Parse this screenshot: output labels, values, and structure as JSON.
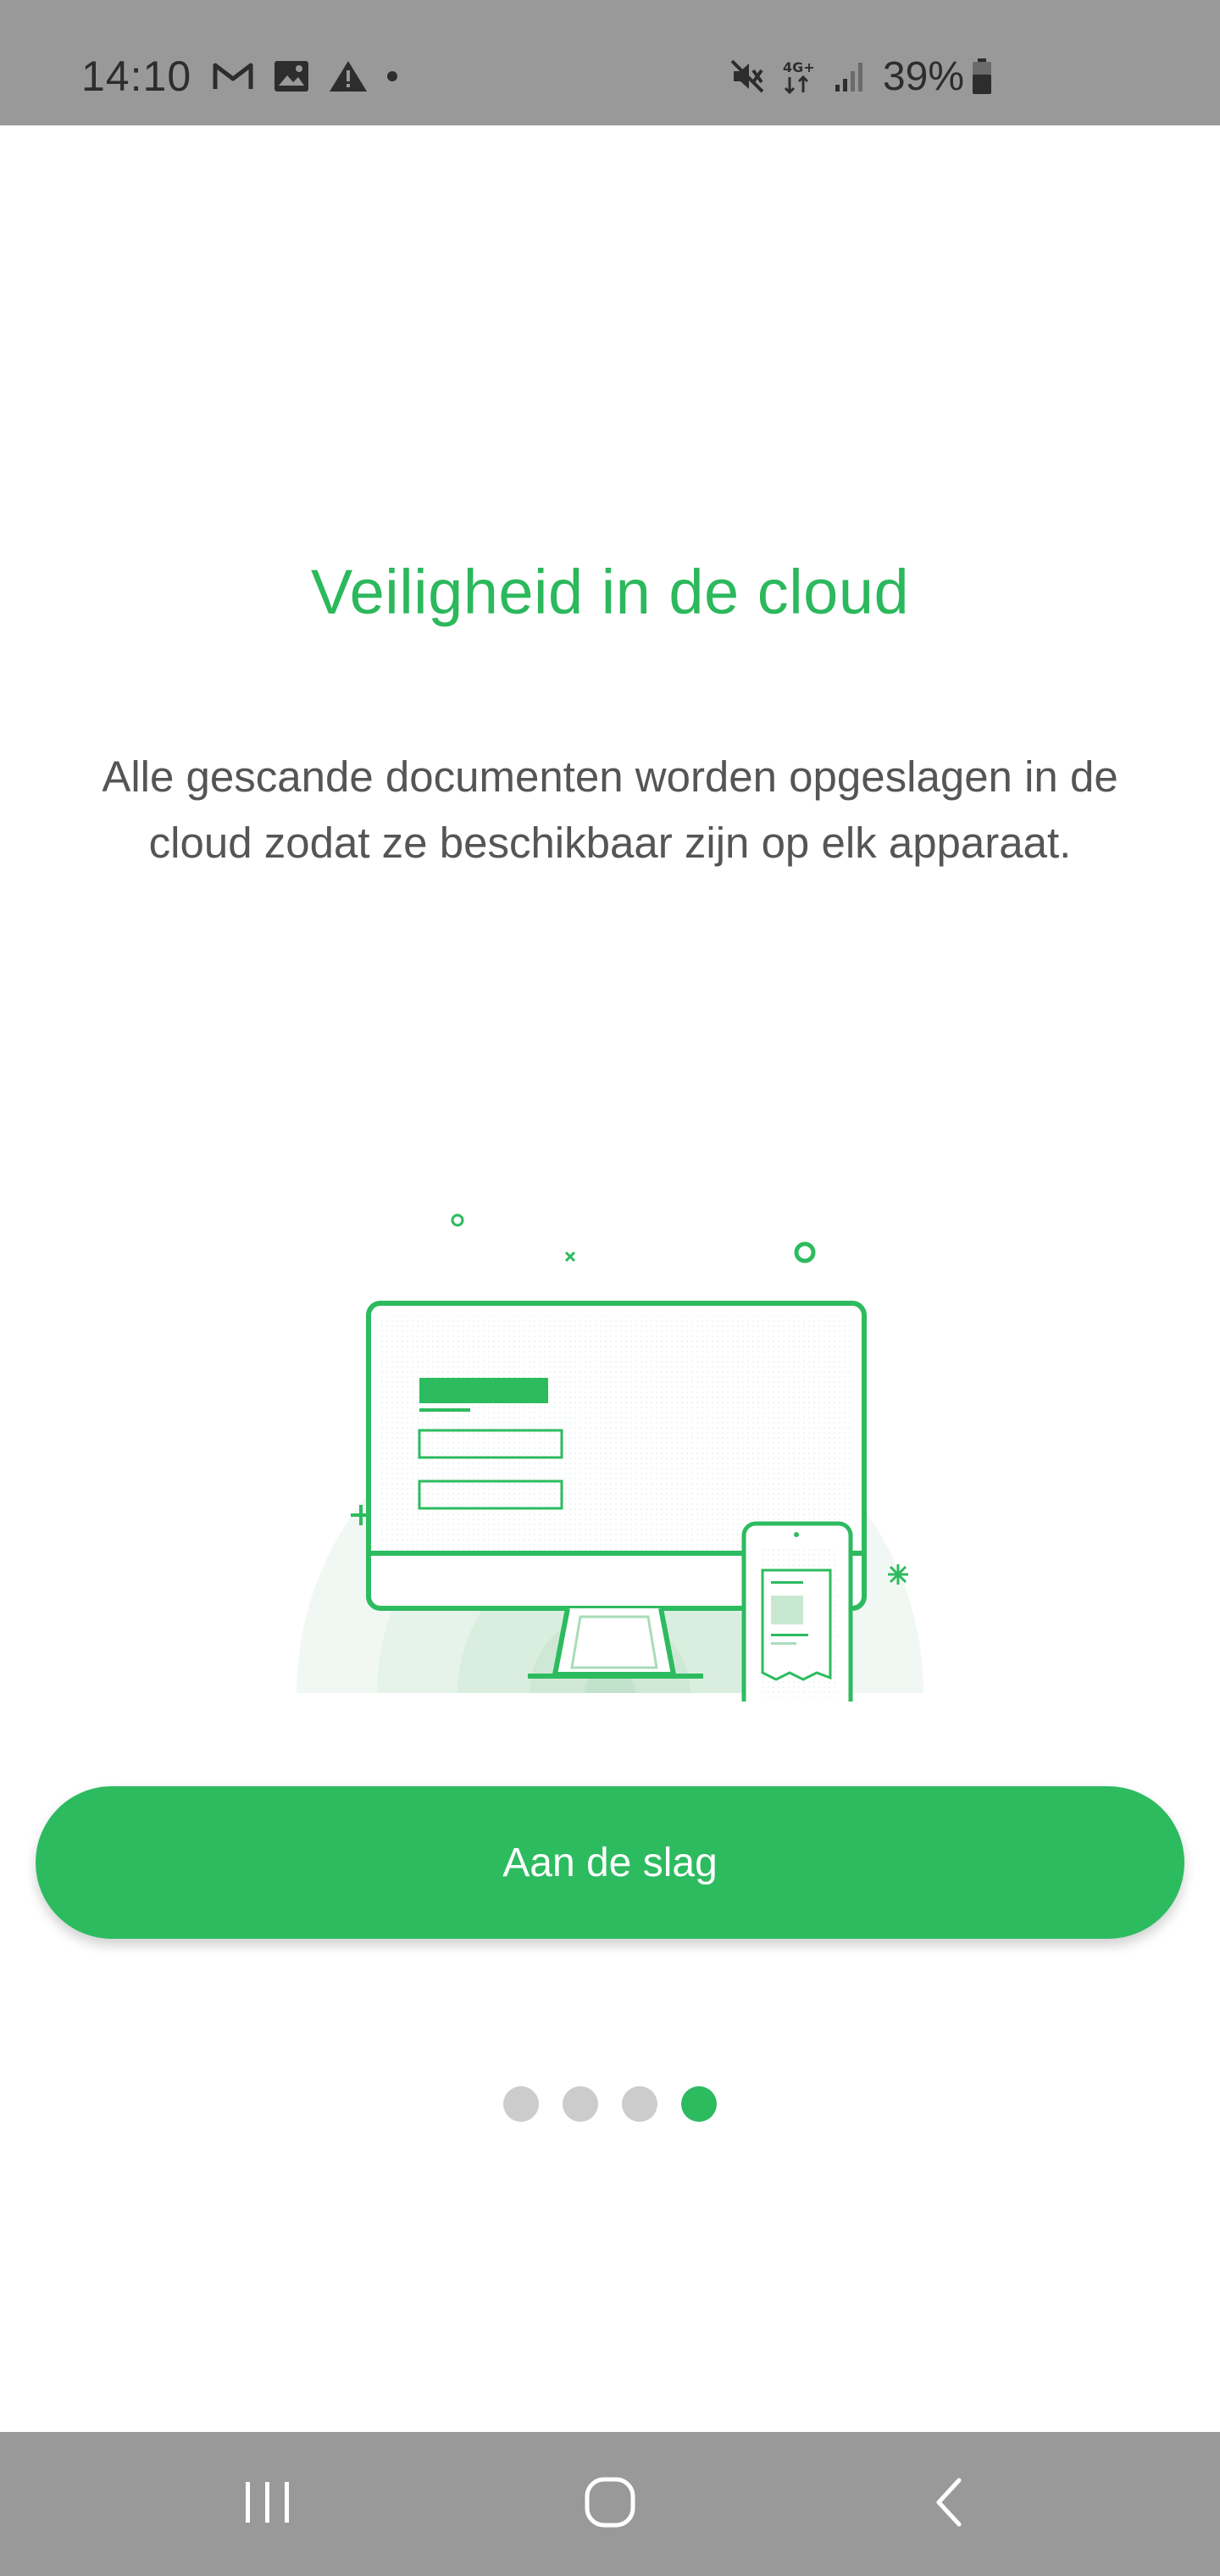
{
  "status_bar": {
    "time": "14:10",
    "battery": "39%",
    "icons": [
      "gmail-icon",
      "gallery-icon",
      "warning-icon",
      "notification-dot-icon",
      "mute-icon",
      "4g-plus-icon",
      "signal-icon",
      "battery-icon"
    ],
    "network_label": "4G+"
  },
  "onboarding": {
    "title": "Veiligheid in de cloud",
    "description": "Alle gescande documenten worden opgeslagen in de cloud zodat ze beschikbaar zijn op elk apparaat.",
    "illustration": "monitor-and-phone-cloud-sync-illustration",
    "cta_label": "Aan de slag"
  },
  "pager": {
    "total": 4,
    "active_index": 3
  },
  "nav_bar": {
    "buttons": [
      "recent-apps-icon",
      "home-icon",
      "back-icon"
    ]
  },
  "colors": {
    "accent": "#2dbb5f",
    "title": "#2cb85c",
    "text": "#555555",
    "system_bars": "#999999",
    "dot_inactive": "#cccccc"
  }
}
